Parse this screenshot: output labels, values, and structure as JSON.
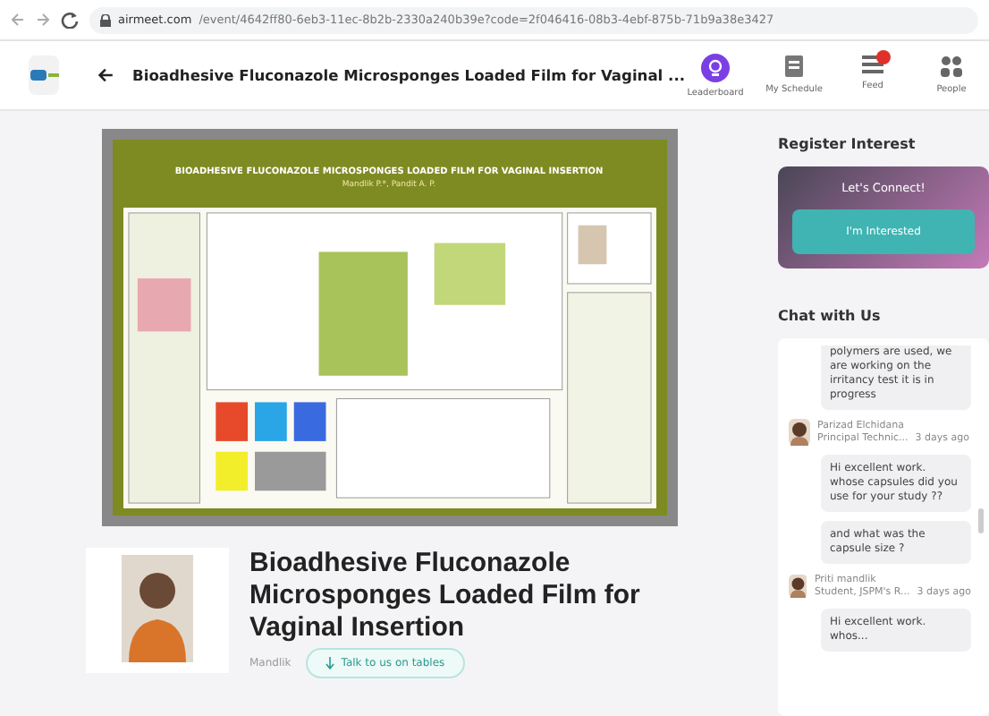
{
  "browser": {
    "url_domain": "airmeet.com",
    "url_path": "/event/4642ff80-6eb3-11ec-8b2b-2330a240b39e?code=2f046416-08b3-4ebf-875b-71b9a38e3427"
  },
  "header": {
    "title": "Bioadhesive Fluconazole Microsponges Loaded Film for Vaginal ...",
    "nav": [
      {
        "label": "Leaderboard",
        "kind": "trophy",
        "badge": false
      },
      {
        "label": "My Schedule",
        "kind": "schedule",
        "badge": false
      },
      {
        "label": "Feed",
        "kind": "feed",
        "badge": true
      },
      {
        "label": "People",
        "kind": "people",
        "badge": false
      }
    ]
  },
  "poster": {
    "title": "BIOADHESIVE FLUCONAZOLE MICROSPONGES LOADED FILM FOR VAGINAL INSERTION",
    "authors": "Mandlik P.*, Pandit A. P."
  },
  "details": {
    "title": "Bioadhesive Fluconazole Microsponges Loaded Film for Vaginal Insertion",
    "author": "Mandlik",
    "talk_button": "Talk to us on tables"
  },
  "register": {
    "heading": "Register Interest",
    "prompt": "Let's Connect!",
    "button": "I'm Interested"
  },
  "chat": {
    "heading": "Chat with Us",
    "items": [
      {
        "kind": "bubble",
        "text": "polymers are used, we are working on the irritancy test it is in progress"
      },
      {
        "kind": "author",
        "name": "Parizad Elchidana",
        "role": "Principal Technic...",
        "time": "3 days ago"
      },
      {
        "kind": "bubble",
        "text": "Hi excellent work. whose capsules did you use for your study ??"
      },
      {
        "kind": "bubble",
        "text": "and what was the capsule size ?"
      },
      {
        "kind": "author",
        "name": "Priti mandlik",
        "role": "Student, JSPM's R...",
        "time": "3 days ago"
      },
      {
        "kind": "bubble",
        "text": "Hi excellent work. whos..."
      }
    ]
  }
}
